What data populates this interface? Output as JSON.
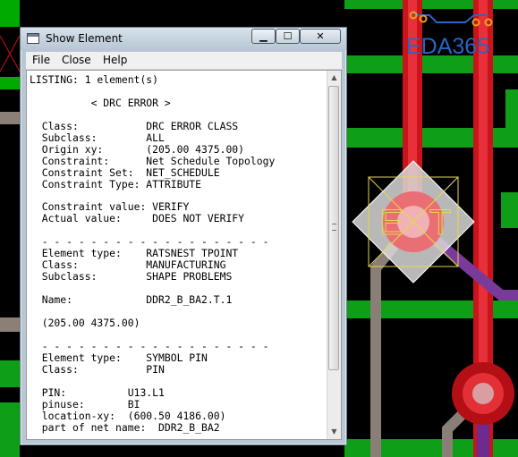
{
  "window": {
    "title": "Show Element",
    "controls": {
      "minimize": "▁",
      "maximize": "☐",
      "close": "✕"
    }
  },
  "menu": [
    "File",
    "Close",
    "Help"
  ],
  "listing_lines": [
    "LISTING: 1 element(s)",
    "",
    "          < DRC ERROR >",
    "",
    "  Class:           DRC ERROR CLASS",
    "  Subclass:        ALL",
    "  Origin xy:       (205.00 4375.00)",
    "  Constraint:      Net Schedule Topology",
    "  Constraint Set:  NET_SCHEDULE",
    "  Constraint Type: ATTRIBUTE",
    "",
    "  Constraint value: VERIFY",
    "  Actual value:     DOES NOT VERIFY",
    "",
    "  - - - - - - - - - - - - - - - - - - -",
    "  Element type:    RATSNEST TPOINT",
    "  Class:           MANUFACTURING",
    "  Subclass:        SHAPE PROBLEMS",
    "",
    "  Name:            DDR2_B_BA2.T.1",
    "",
    "  (205.00 4375.00)",
    "",
    "  - - - - - - - - - - - - - - - - - - -",
    "  Element type:    SYMBOL PIN",
    "  Class:           PIN",
    "",
    "  PIN:          U13.L1",
    "  pinuse:       BI",
    "  location-xy:  (600.50 4186.00)",
    "  part of net name:  DDR2_B_BA2"
  ],
  "watermark": "EDA365",
  "colors": {
    "board_bg": "#000000",
    "green_trace": "#0fa619",
    "red_trace": "#d4161c",
    "highlight": "#e5e5e5",
    "logo_blue": "#2a64c5"
  }
}
